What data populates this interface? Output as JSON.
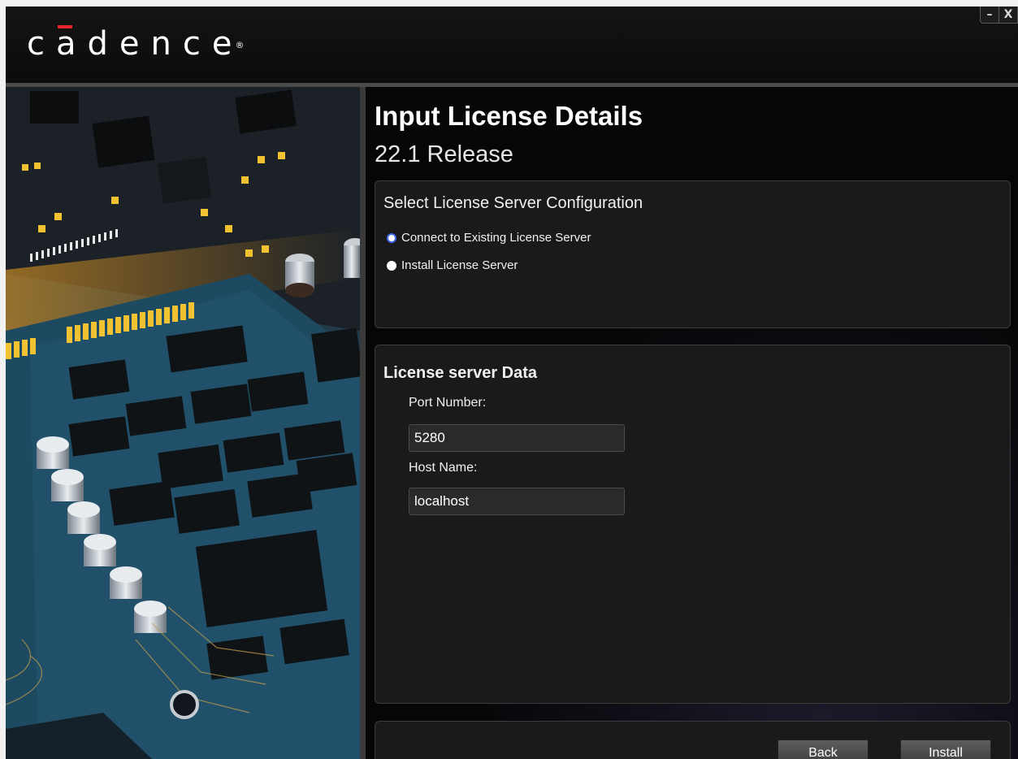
{
  "app": {
    "logo_text": "cadence",
    "registered_mark": "®"
  },
  "window_controls": {
    "minimize": "–",
    "close": "X"
  },
  "page": {
    "title": "Input License Details",
    "subtitle": "22.1 Release"
  },
  "config_panel": {
    "heading": "Select License Server Configuration",
    "options": [
      {
        "label": "Connect to Existing License Server",
        "selected": true
      },
      {
        "label": "Install License Server",
        "selected": false
      }
    ]
  },
  "license_panel": {
    "heading": "License server Data",
    "port_label": "Port Number:",
    "port_value": "5280",
    "host_label": "Host Name:",
    "host_value": "localhost"
  },
  "footer": {
    "back_label": "Back",
    "install_label": "Install"
  },
  "colors": {
    "accent_radio": "#3b6cf0",
    "logo_macron": "#e2262b",
    "background": "#121212"
  }
}
